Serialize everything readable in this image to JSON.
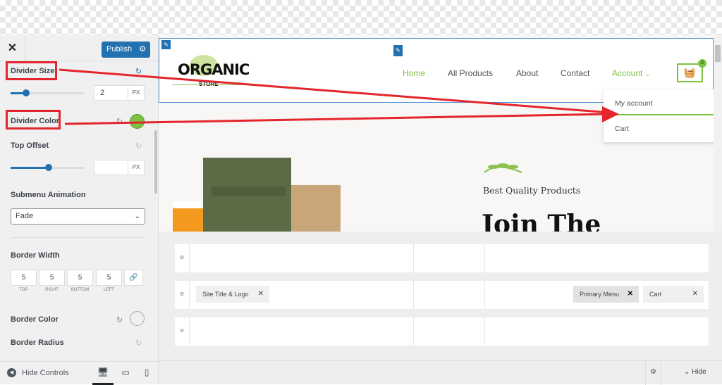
{
  "colors": {
    "accent": "#2271b1",
    "brand_green": "#7dc242",
    "annotation_red": "#e3262d"
  },
  "sidebar": {
    "close_icon": "close-icon",
    "publish_label": "Publish",
    "publish_settings_icon": "gear-icon",
    "divider_size": {
      "label": "Divider Size",
      "value": "2",
      "unit": "PX",
      "slider_fraction": 0.2
    },
    "divider_color": {
      "label": "Divider Color",
      "value": "#7dc242"
    },
    "top_offset": {
      "label": "Top Offset",
      "value": "",
      "unit": "PX",
      "slider_fraction": 0.5
    },
    "submenu_animation": {
      "label": "Submenu Animation",
      "selected": "Fade"
    },
    "border_width": {
      "label": "Border Width",
      "values": [
        "5",
        "5",
        "5",
        "5"
      ],
      "sides": [
        "TOP",
        "RIGHT",
        "BOTTOM",
        "LEFT"
      ],
      "link_icon": "link-icon"
    },
    "border_color": {
      "label": "Border Color",
      "value": "#f0f0f1"
    },
    "border_radius": {
      "label": "Border Radius"
    },
    "footer": {
      "hide_controls": "Hide Controls",
      "devices": [
        "desktop",
        "tablet",
        "mobile"
      ]
    }
  },
  "preview": {
    "logo_text": "ORGANIC",
    "logo_sub": "STORE",
    "nav": [
      "Home",
      "All Products",
      "About",
      "Contact",
      "Account"
    ],
    "active_nav": "Home",
    "cart_count": "0",
    "submenu": [
      "My account",
      "Cart"
    ],
    "hero_subtitle": "Best Quality Products",
    "hero_title": "Join The"
  },
  "builder": {
    "rows": [
      {
        "left": [],
        "right": []
      },
      {
        "left": [
          "Site Title & Logo"
        ],
        "right": [
          "Primary Menu",
          "Cart"
        ]
      },
      {
        "left": [],
        "right": []
      }
    ],
    "hide_label": "Hide"
  }
}
